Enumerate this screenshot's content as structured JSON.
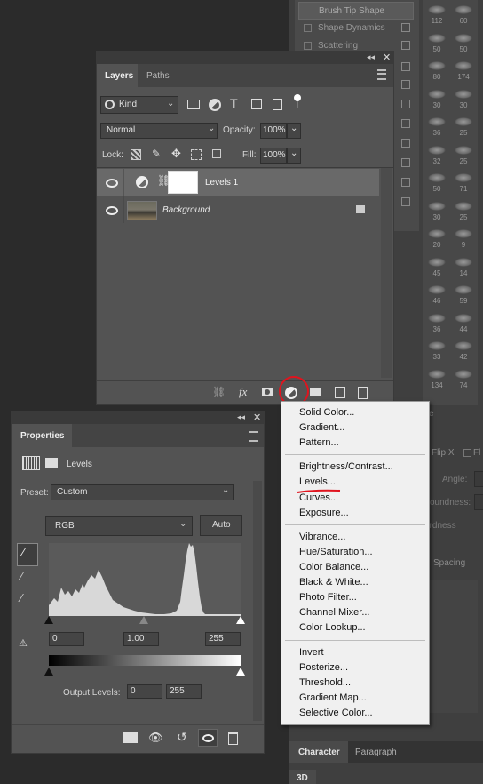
{
  "brush_panel": {
    "items": [
      "Brush Tip Shape",
      "Shape Dynamics",
      "Scattering"
    ],
    "sizes_col1": [
      "112",
      "50",
      "80",
      "30",
      "36",
      "32",
      "50",
      "30",
      "20",
      "45",
      "46",
      "36",
      "33",
      "134"
    ],
    "sizes_col2": [
      "60",
      "50",
      "174",
      "30",
      "25",
      "25",
      "71",
      "25",
      "9",
      "14",
      "59",
      "44",
      "42",
      "74"
    ],
    "size_label": "ze",
    "flip_x": "Flip X",
    "flip_y": "Fl",
    "angle": "Angle:",
    "roundness": "oundness:",
    "hardness": "ardness",
    "spacing": "Spacing"
  },
  "bottom_tabs": {
    "character": "Character",
    "paragraph": "Paragraph",
    "threed": "3D"
  },
  "layers_panel": {
    "tabs": [
      "Layers",
      "Paths"
    ],
    "filter_kind": "Kind",
    "blend_mode": "Normal",
    "opacity_label": "Opacity:",
    "opacity_value": "100%",
    "lock_label": "Lock:",
    "fill_label": "Fill:",
    "fill_value": "100%",
    "layers": [
      {
        "name": "Levels 1"
      },
      {
        "name": "Background"
      }
    ],
    "fx_label": "fx"
  },
  "properties_panel": {
    "tab": "Properties",
    "title": "Levels",
    "preset_label": "Preset:",
    "preset_value": "Custom",
    "channel": "RGB",
    "auto_label": "Auto",
    "input_black": "0",
    "input_gamma": "1.00",
    "input_white": "255",
    "output_label": "Output Levels:",
    "output_black": "0",
    "output_white": "255"
  },
  "adjustment_menu": {
    "group1": [
      "Solid Color...",
      "Gradient...",
      "Pattern..."
    ],
    "group2": [
      "Brightness/Contrast...",
      "Levels...",
      "Curves...",
      "Exposure..."
    ],
    "group3": [
      "Vibrance...",
      "Hue/Saturation...",
      "Color Balance...",
      "Black & White...",
      "Photo Filter...",
      "Channel Mixer...",
      "Color Lookup..."
    ],
    "group4": [
      "Invert",
      "Posterize...",
      "Threshold...",
      "Gradient Map...",
      "Selective Color..."
    ]
  },
  "colors": {
    "annotation_red": "#e0141e",
    "panel_bg": "#535353",
    "selected_layer": "#696969"
  },
  "icons": [
    "search-icon",
    "image-filter-icon",
    "adjustment-filter-icon",
    "type-filter-icon",
    "shape-filter-icon",
    "smartobject-filter-icon",
    "toggle-filter-icon",
    "eye-icon",
    "link-icon",
    "lock-icon",
    "mask-icon",
    "new-group-icon",
    "new-layer-icon",
    "trash-icon",
    "eyedropper-icon",
    "clip-icon",
    "reset-icon"
  ]
}
